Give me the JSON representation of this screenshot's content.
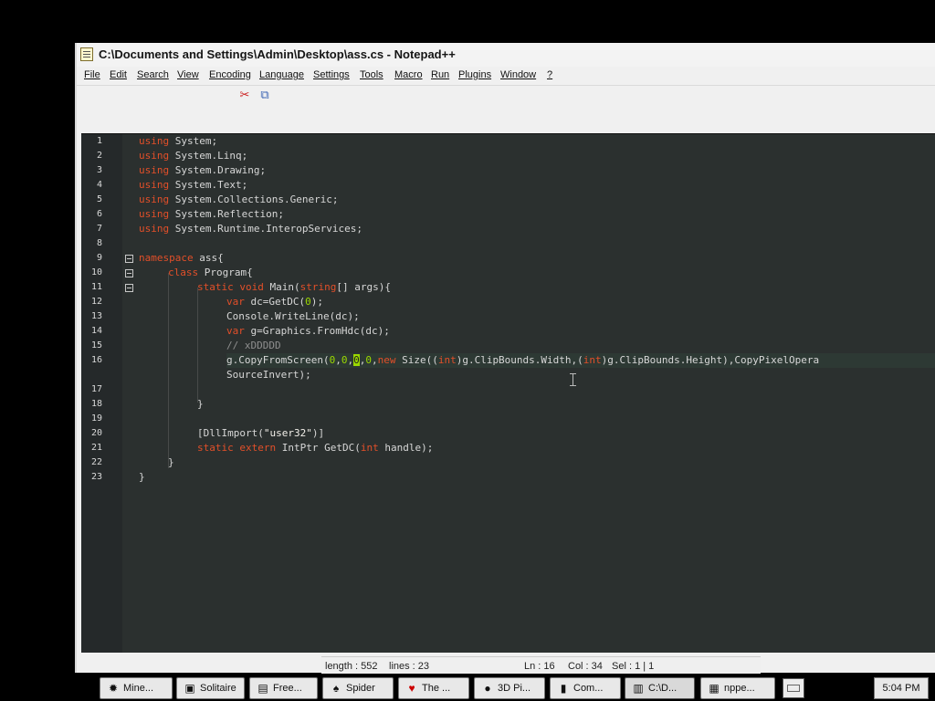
{
  "window": {
    "title": "C:\\Documents and Settings\\Admin\\Desktop\\ass.cs - Notepad++"
  },
  "menu": [
    "File",
    "Edit",
    "Search",
    "View",
    "Encoding",
    "Language",
    "Settings",
    "Tools",
    "Macro",
    "Run",
    "Plugins",
    "Window",
    "?"
  ],
  "toolbar": {
    "icons": [
      "cut-icon",
      "copy-icon"
    ]
  },
  "editor": {
    "line_numbers": [
      "1",
      "2",
      "3",
      "4",
      "5",
      "6",
      "7",
      "8",
      "9",
      "10",
      "11",
      "12",
      "13",
      "14",
      "15",
      "16",
      "17",
      "18",
      "19",
      "20",
      "21",
      "22",
      "23"
    ],
    "code": {
      "l1": {
        "kw": "using",
        "rest": " System;"
      },
      "l2": {
        "kw": "using",
        "rest": " System.Linq;"
      },
      "l3": {
        "kw": "using",
        "rest": " System.Drawing;"
      },
      "l4": {
        "kw": "using",
        "rest": " System.Text;"
      },
      "l5": {
        "kw": "using",
        "rest": " System.Collections.Generic;"
      },
      "l6": {
        "kw": "using",
        "rest": " System.Reflection;"
      },
      "l7": {
        "kw": "using",
        "rest": " System.Runtime.InteropServices;"
      },
      "l9": {
        "kw": "namespace",
        "rest": " ass{"
      },
      "l10": {
        "kw": "class",
        "rest": " Program{"
      },
      "l11": {
        "kw1": "static",
        "kw2": "void",
        "main": " Main(",
        "type": "string",
        "rest": "[] args){"
      },
      "l12": {
        "kw": "var",
        "pre": " dc=GetDC(",
        "num": "0",
        "post": ");"
      },
      "l13": {
        "text": "Console.WriteLine(dc);"
      },
      "l14": {
        "kw": "var",
        "rest": " g=Graphics.FromHdc(dc);"
      },
      "l15": {
        "comment": "// xDDDDD"
      },
      "l16": {
        "a": "g.CopyFromScreen(",
        "n1": "0",
        "c1": ",",
        "n2": "0",
        "c2": ",",
        "n3": "0",
        "c3": ",",
        "n4": "0",
        "c4": ",",
        "kw": "new",
        "b": " Size((",
        "kw2": "int",
        "c": ")g.ClipBounds.Width,(",
        "kw3": "int",
        "d": ")g.ClipBounds.Height),CopyPixelOpera"
      },
      "l16b": {
        "text": "SourceInvert);"
      },
      "l18": {
        "text": "}"
      },
      "l20": {
        "pre": "[DllImport(",
        "str": "\"user32\"",
        "post": ")]"
      },
      "l21": {
        "kw1": "static",
        "kw2": "extern",
        "rest": " IntPtr GetDC(",
        "type": "int",
        "end": " handle);"
      },
      "l22": {
        "text": "}"
      },
      "l23": {
        "text": "}"
      }
    }
  },
  "status": {
    "length": "length : 552",
    "lines": "lines : 23",
    "ln": "Ln : 16",
    "col": "Col : 34",
    "sel": "Sel : 1 | 1"
  },
  "taskbar": [
    {
      "label": "Mine...",
      "icon": "mine-icon"
    },
    {
      "label": "Solitaire",
      "icon": "solitaire-icon"
    },
    {
      "label": "Free...",
      "icon": "freecell-icon"
    },
    {
      "label": "Spider",
      "icon": "spider-icon"
    },
    {
      "label": "The ...",
      "icon": "hearts-icon"
    },
    {
      "label": "3D Pi...",
      "icon": "pinball-icon"
    },
    {
      "label": "Com...",
      "icon": "command-icon"
    },
    {
      "label": "C:\\D...",
      "icon": "notepad-icon"
    },
    {
      "label": "nppe...",
      "icon": "npp-icon"
    }
  ],
  "clock": "5:04 PM"
}
